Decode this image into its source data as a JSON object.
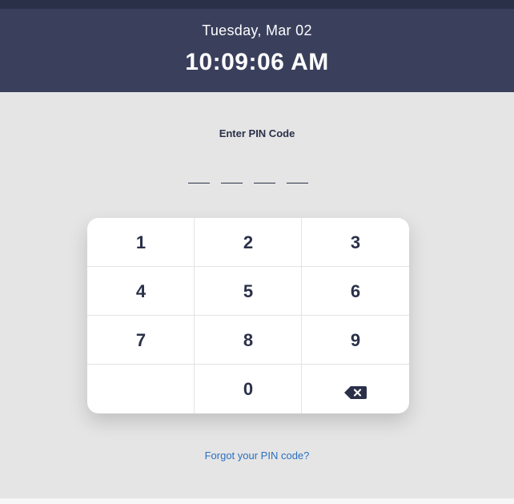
{
  "header": {
    "date": "Tuesday, Mar 02",
    "time": "10:09:06 AM"
  },
  "pin": {
    "label": "Enter PIN Code",
    "slots": 4,
    "entered": 0
  },
  "keypad": {
    "keys": [
      "1",
      "2",
      "3",
      "4",
      "5",
      "6",
      "7",
      "8",
      "9",
      "",
      "0",
      "backspace"
    ],
    "backspace_icon": "backspace-icon"
  },
  "links": {
    "forgot": "Forgot your PIN code?"
  },
  "colors": {
    "header_bg": "#3a3f5c",
    "accent": "#2b3049",
    "link": "#2b6fc0",
    "page_bg": "#e5e5e5"
  }
}
